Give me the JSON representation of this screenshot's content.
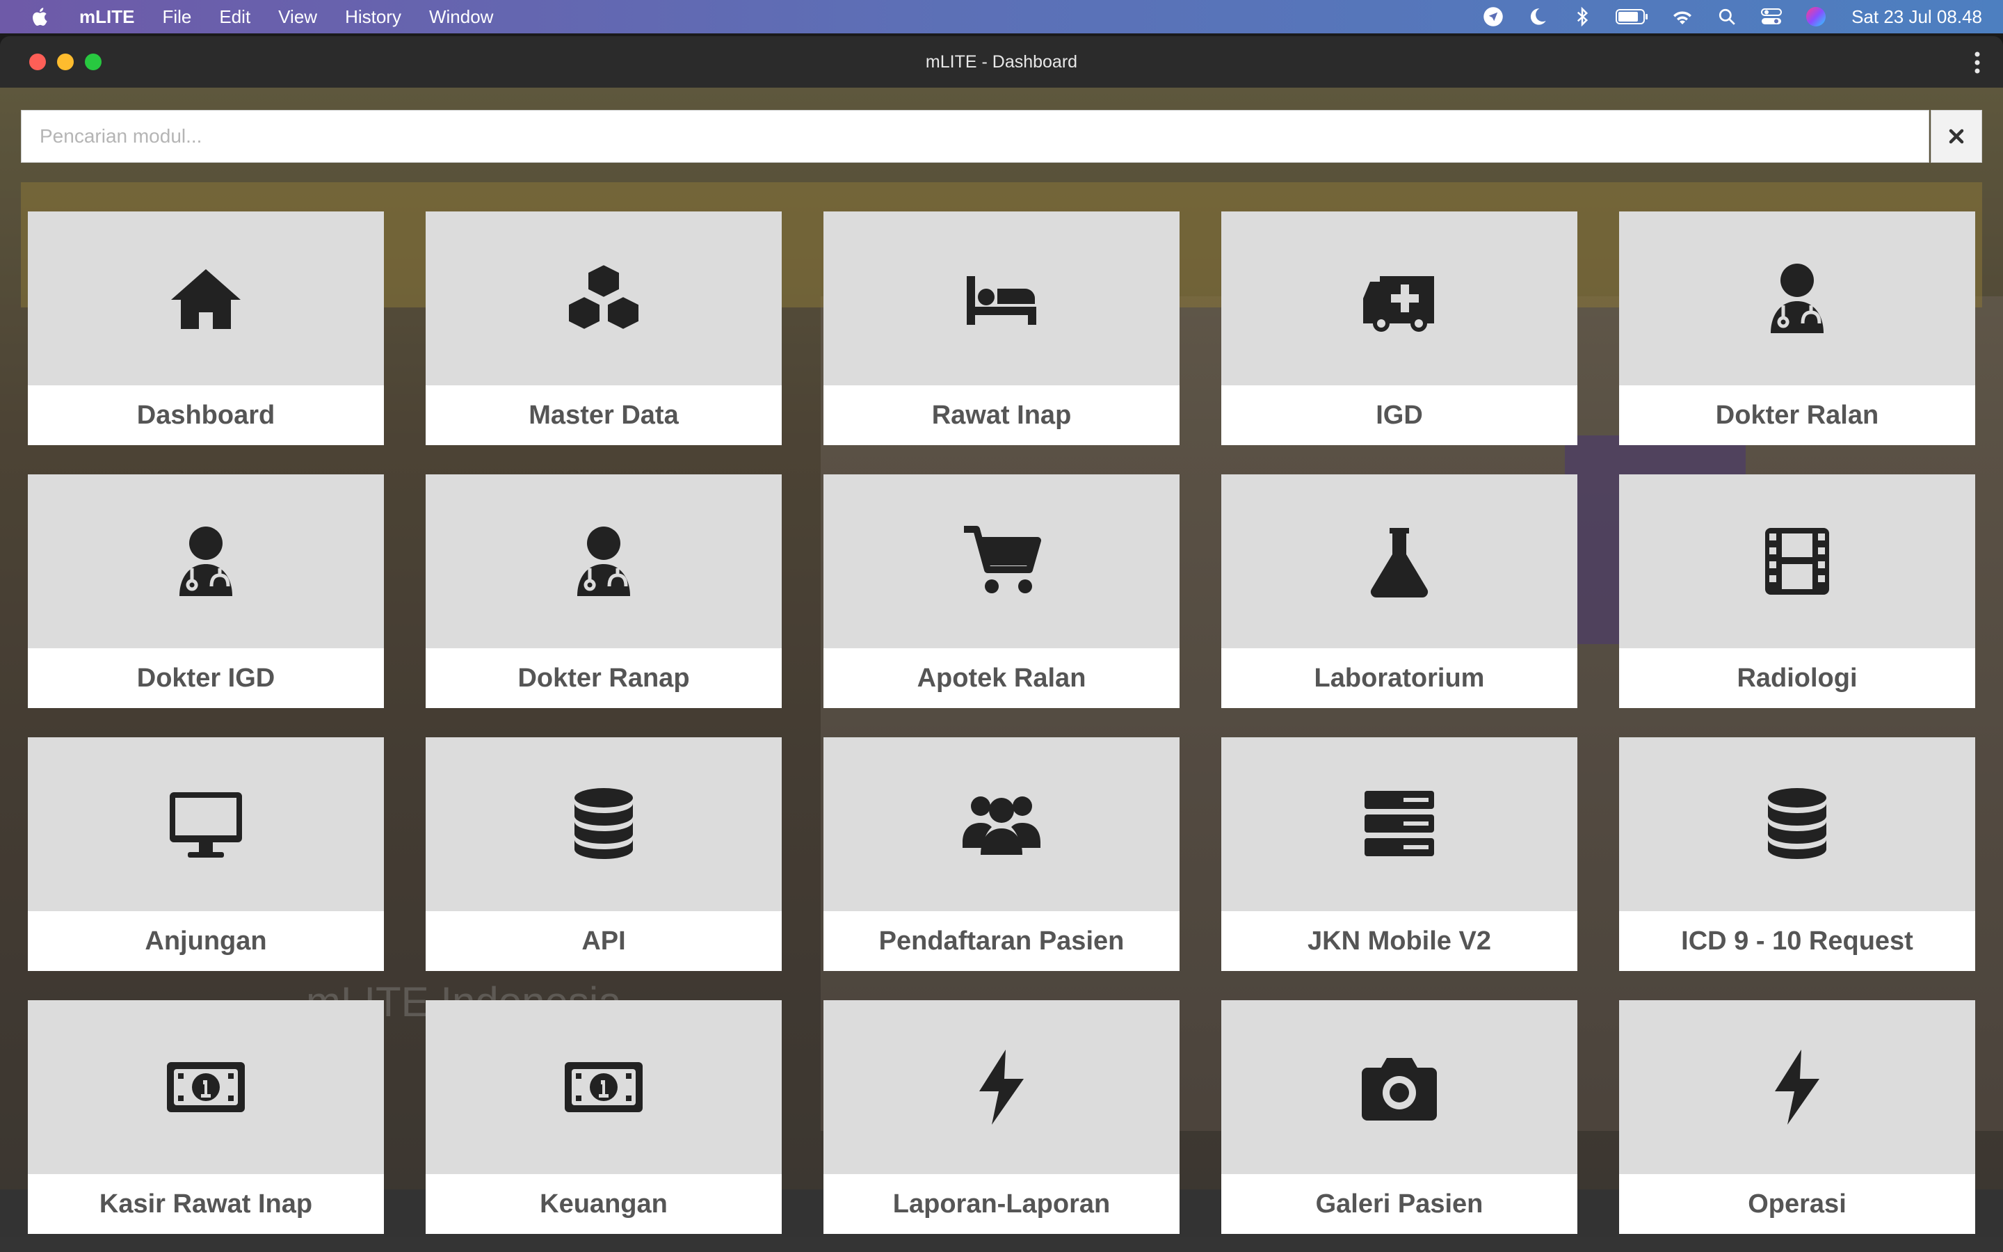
{
  "menubar": {
    "app_name": "mLITE",
    "items": [
      "File",
      "Edit",
      "View",
      "History",
      "Window"
    ],
    "clock": "Sat 23 Jul  08.48",
    "status_icons": [
      "location-icon",
      "moon-icon",
      "bluetooth-icon",
      "battery-icon",
      "wifi-icon",
      "search-icon",
      "control-center-icon",
      "siri-icon"
    ]
  },
  "window": {
    "title": "mLITE - Dashboard"
  },
  "search": {
    "placeholder": "Pencarian modul..."
  },
  "background": {
    "brand": "mLITE Indonesia"
  },
  "modules": [
    {
      "label": "Dashboard",
      "icon": "home-icon"
    },
    {
      "label": "Master Data",
      "icon": "cubes-icon"
    },
    {
      "label": "Rawat Inap",
      "icon": "bed-icon"
    },
    {
      "label": "IGD",
      "icon": "ambulance-icon"
    },
    {
      "label": "Dokter Ralan",
      "icon": "doctor-icon"
    },
    {
      "label": "Dokter IGD",
      "icon": "doctor-icon"
    },
    {
      "label": "Dokter Ranap",
      "icon": "doctor-icon"
    },
    {
      "label": "Apotek Ralan",
      "icon": "cart-icon"
    },
    {
      "label": "Laboratorium",
      "icon": "flask-icon"
    },
    {
      "label": "Radiologi",
      "icon": "film-icon"
    },
    {
      "label": "Anjungan",
      "icon": "desktop-icon"
    },
    {
      "label": "API",
      "icon": "database-icon"
    },
    {
      "label": "Pendaftaran Pasien",
      "icon": "users-icon"
    },
    {
      "label": "JKN Mobile V2",
      "icon": "server-icon"
    },
    {
      "label": "ICD 9 - 10 Request",
      "icon": "database-icon"
    },
    {
      "label": "Kasir Rawat Inap",
      "icon": "money-icon"
    },
    {
      "label": "Keuangan",
      "icon": "money-icon"
    },
    {
      "label": "Laporan-Laporan",
      "icon": "bolt-icon"
    },
    {
      "label": "Galeri Pasien",
      "icon": "camera-icon"
    },
    {
      "label": "Operasi",
      "icon": "bolt-icon"
    }
  ]
}
